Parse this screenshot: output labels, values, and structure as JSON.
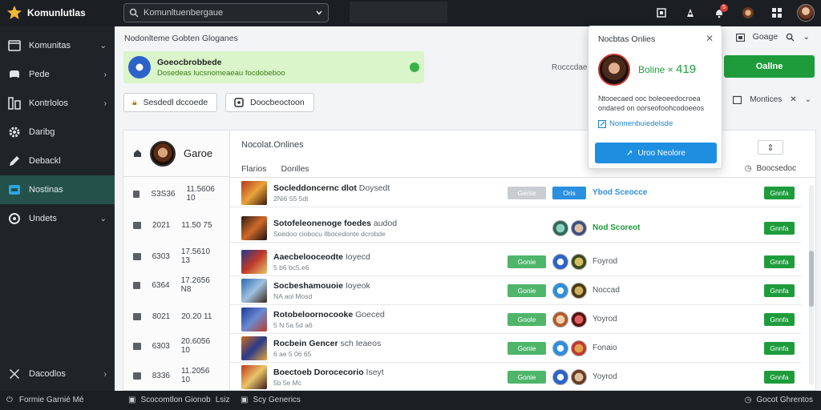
{
  "app": {
    "name": "Komunlutlas"
  },
  "search": {
    "value": "Komunltuenbergaue"
  },
  "topbar": {
    "notif_count": "5"
  },
  "sidebar": {
    "items": [
      {
        "label": "Komunitas",
        "icon": "group-icon"
      },
      {
        "label": "Pede",
        "icon": "gamepad-icon"
      },
      {
        "label": "Kontrlolos",
        "icon": "controls-icon"
      },
      {
        "label": "Daribg",
        "icon": "gear-icon"
      },
      {
        "label": "Debackl",
        "icon": "pen-icon"
      },
      {
        "label": "Nostinas",
        "icon": "inbox-icon"
      },
      {
        "label": "Undets",
        "icon": "circle-icon"
      }
    ],
    "footer_item": {
      "label": "Dacodlos"
    }
  },
  "statusbar": {
    "left": "Formie Garnié Mé",
    "mid1_a": "Scocomtlon Gionob",
    "mid1_b": "Lsiz",
    "mid2": "Scy Generics",
    "right": "Gocot Ghrentos"
  },
  "main": {
    "breadcrumb": "Nodonlteme Gobten Gloganes",
    "alert": {
      "title": "Goeocbrobbede",
      "subtitle": "Dosedeas lucsnomeaeau focdobeboo"
    },
    "btn_find": "Sesdedl dccoede",
    "btn_connect": "Doocbeoctoon",
    "mid_text": "Rocccdaecer",
    "online_button": "Oallne",
    "top_tool": "Goage",
    "filter_label": "Montices"
  },
  "panel": {
    "game_name": "Garoe",
    "rows": [
      {
        "a": "S3S36",
        "b": "11.5606 10"
      },
      {
        "a": "2021",
        "b": "11.50 75"
      },
      {
        "a": "6303",
        "b": "17.5610 13"
      },
      {
        "a": "6364",
        "b": "17.2656 N8"
      },
      {
        "a": "8021",
        "b": "20.20 11"
      },
      {
        "a": "6303",
        "b": "20.6056 10"
      },
      {
        "a": "8336",
        "b": "11.2056 10"
      }
    ],
    "title": "Nocolat.Onlines",
    "tabs": [
      "Flarios",
      "Donlles"
    ],
    "meta": "Boocsedoc",
    "games": [
      {
        "title": "Socleddoncernc dlot",
        "sub": "Doysedt",
        "meta": "2Ni6 55 5dt",
        "pill1": "Genie",
        "pill1_style": "gray",
        "pill2": "Oris",
        "status": "Ybod Sceocce",
        "status_style": "blue",
        "action": "Gnnfa"
      },
      {
        "title": "Sotofeleonenoge foedes",
        "sub": "audod",
        "meta": "Soedoo ciobocu llbocedonte dcrobde",
        "pill1": "",
        "pill1_style": "none",
        "pill2": "",
        "status": "Nod Scoreot",
        "status_style": "green",
        "action": "Gnnfa"
      },
      {
        "title": "Aaecbelooceodte",
        "sub": "Ioyecd",
        "meta": "5 b6 bc5.e6",
        "pill1": "Gonie",
        "pill1_style": "green",
        "pill2": "",
        "status": "Foyrod",
        "status_style": "gray",
        "action": "Gnnfa"
      },
      {
        "title": "Socbeshamouoie",
        "sub": "Ioyeok",
        "meta": "NA aol Mosd",
        "pill1": "Gonie",
        "pill1_style": "green",
        "pill2": "",
        "status": "Noccad",
        "status_style": "gray",
        "action": "Gnnfa"
      },
      {
        "title": "Rotobeloornocooke",
        "sub": "Goeced",
        "meta": "5 N 5a 5d a6",
        "pill1": "Goole",
        "pill1_style": "green",
        "pill2": "",
        "status": "Yoyrod",
        "status_style": "gray",
        "action": "Gnnfa"
      },
      {
        "title": "Rocbein Gencer",
        "sub": "sch Ieaeos",
        "meta": "6 ae 5 06 65",
        "pill1": "Gonie",
        "pill1_style": "green",
        "pill2": "",
        "status": "Fonaio",
        "status_style": "gray",
        "action": "Gnnfa"
      },
      {
        "title": "Boectoeb Dorocecorio",
        "sub": "Iseyt",
        "meta": "5b 5e Mc",
        "pill1": "Gonie",
        "pill1_style": "green",
        "pill2": "",
        "status": "Yoyrod",
        "status_style": "gray",
        "action": "Gnnfa"
      }
    ]
  },
  "popup": {
    "title": "Nocbtas Onlies",
    "stat_label": "Boline ×",
    "stat_value": "419",
    "desc": "Ntooecaed ooc boleoeedocroea ondared on oorseofoohcodoeeos",
    "link": "Nonnenbuiedelsde",
    "button": "Uroo Neolore"
  },
  "colors": {
    "accent_green": "#1e9c3c",
    "accent_blue": "#1e8fe0",
    "sidebar_active": "#24514a"
  }
}
